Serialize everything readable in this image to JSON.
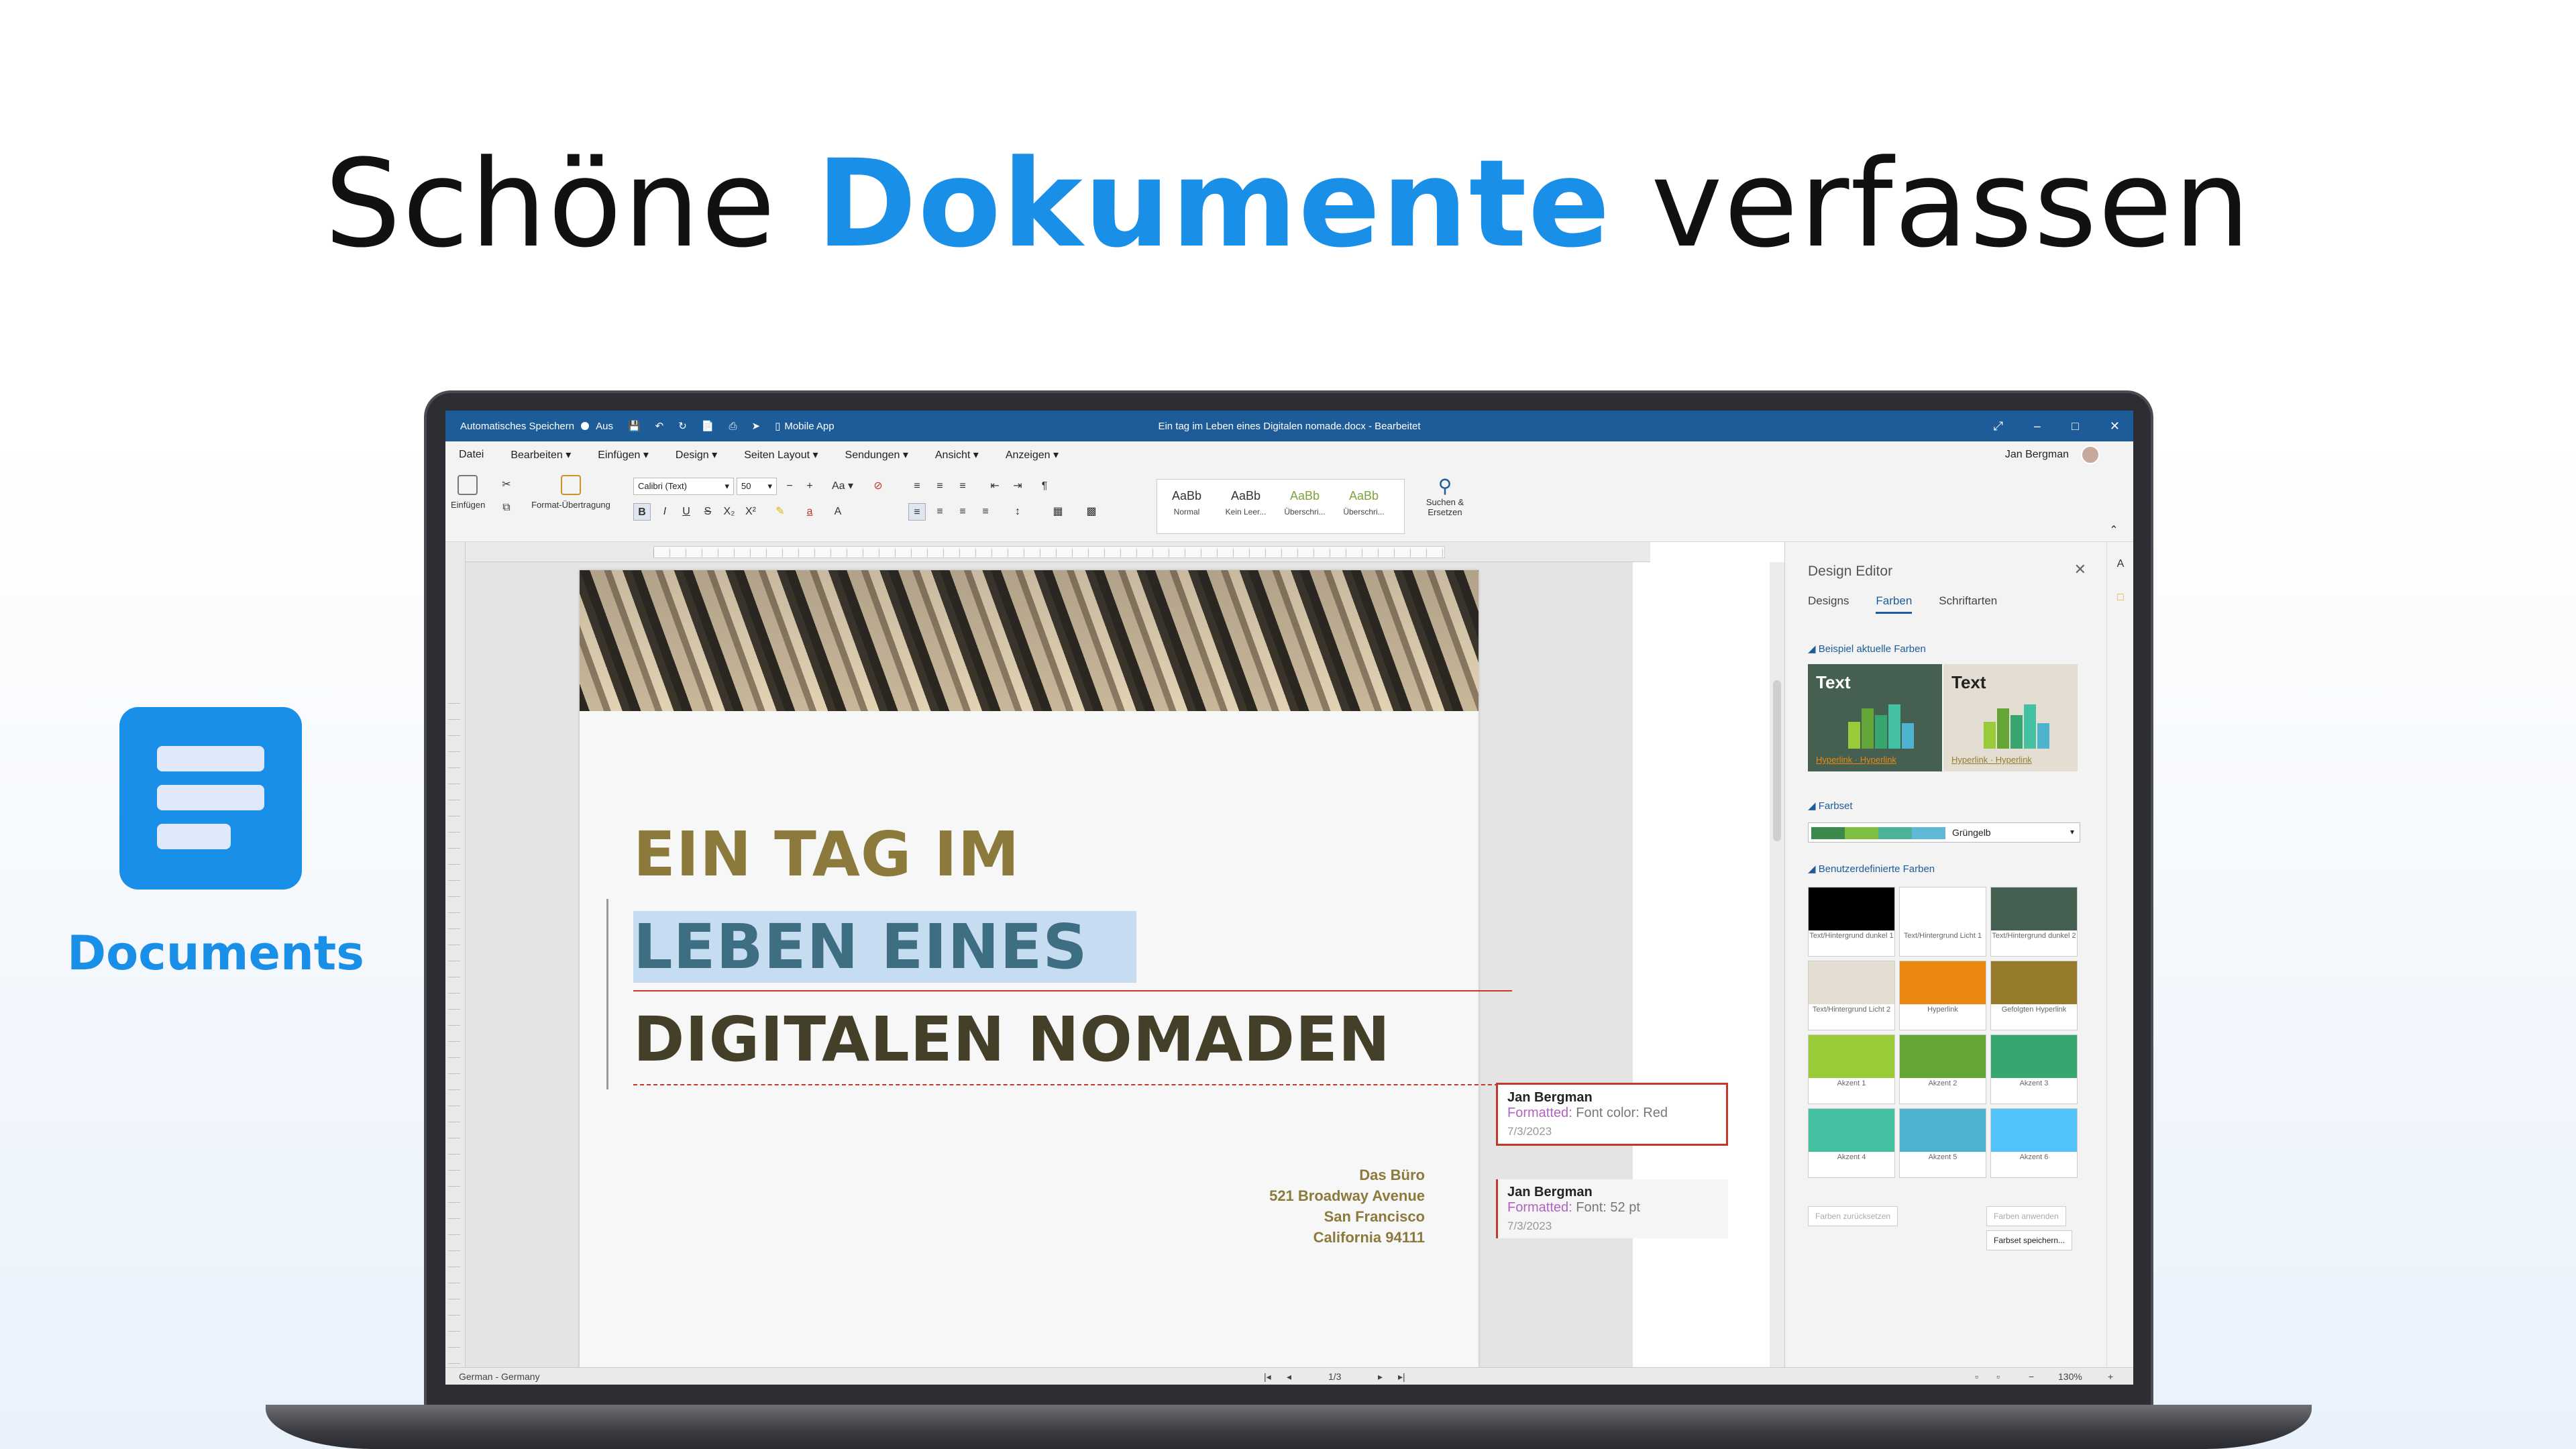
{
  "headline": {
    "part1": "Schöne ",
    "highlight": "Dokumente",
    "part2": " verfassen"
  },
  "brand": {
    "name": "Documents",
    "color": "#1a8fe8"
  },
  "titlebar": {
    "autosave_label": "Automatisches Speichern",
    "autosave_state": "Aus",
    "mobile_app": "Mobile App",
    "document_title": "Ein tag im Leben eines Digitalen nomade.docx - Bearbeitet",
    "color": "#1d5c98"
  },
  "menu": {
    "items": [
      "Datei",
      "Bearbeiten",
      "Einfügen",
      "Design",
      "Seiten Layout",
      "Sendungen",
      "Ansicht",
      "Anzeigen"
    ],
    "user": "Jan Bergman"
  },
  "ribbon": {
    "paste": "Einfügen",
    "format_painter": "Format-Übertragung",
    "font": "Calibri (Text)",
    "size": "50",
    "case": "Aa",
    "find_replace": "Suchen & Ersetzen",
    "styles": [
      {
        "sample": "AaBb",
        "name": "Normal"
      },
      {
        "sample": "AaBb",
        "name": "Kein Leer..."
      },
      {
        "sample": "AaBb",
        "name": "Überschri..."
      },
      {
        "sample": "AaBb",
        "name": "Überschri..."
      }
    ]
  },
  "document": {
    "line1": "EIN TAG IM",
    "line2": "LEBEN EINES",
    "line3": "DIGITALEN NOMADEN",
    "address": [
      "Das Büro",
      "521 Broadway Avenue",
      "San Francisco",
      "California 94111"
    ]
  },
  "comments": [
    {
      "author": "Jan Bergman",
      "label": "Formatted:",
      "detail": " Font color: Red",
      "date": "7/3/2023"
    },
    {
      "author": "Jan Bergman",
      "label": "Formatted:",
      "detail": " Font: 52 pt",
      "date": "7/3/2023"
    }
  ],
  "panel": {
    "title": "Design Editor",
    "tabs": [
      "Designs",
      "Farben",
      "Schriftarten"
    ],
    "active_tab": "Farben",
    "section_preview": "Beispiel aktuelle Farben",
    "preview_text": "Text",
    "preview_links": "Hyperlink · Hyperlink",
    "section_farbset": "Farbset",
    "farbset_value": "Grüngelb",
    "section_custom": "Benutzerdefinierte Farben",
    "swatches": [
      {
        "label": "Text/Hintergrund dunkel 1",
        "color": "#000000"
      },
      {
        "label": "Text/Hintergrund Licht 1",
        "color": "#ffffff"
      },
      {
        "label": "Text/Hintergrund dunkel 2",
        "color": "#455f51"
      },
      {
        "label": "Text/Hintergrund Licht 2",
        "color": "#e3ded1"
      },
      {
        "label": "Hyperlink",
        "color": "#eb880f"
      },
      {
        "label": "Gefolgten Hyperlink",
        "color": "#977b2d"
      },
      {
        "label": "Akzent 1",
        "color": "#99cb38"
      },
      {
        "label": "Akzent 2",
        "color": "#63a537"
      },
      {
        "label": "Akzent 3",
        "color": "#37a76f"
      },
      {
        "label": "Akzent 4",
        "color": "#44c1a3"
      },
      {
        "label": "Akzent 5",
        "color": "#4eb3cf"
      },
      {
        "label": "Akzent 6",
        "color": "#51c3f9"
      }
    ],
    "reset_btn": "Farben zurücksetzen",
    "apply_btn": "Farben anwenden",
    "save_btn": "Farbset speichern..."
  },
  "status": {
    "language": "German - Germany",
    "page": "1/3",
    "zoom": "130%"
  }
}
